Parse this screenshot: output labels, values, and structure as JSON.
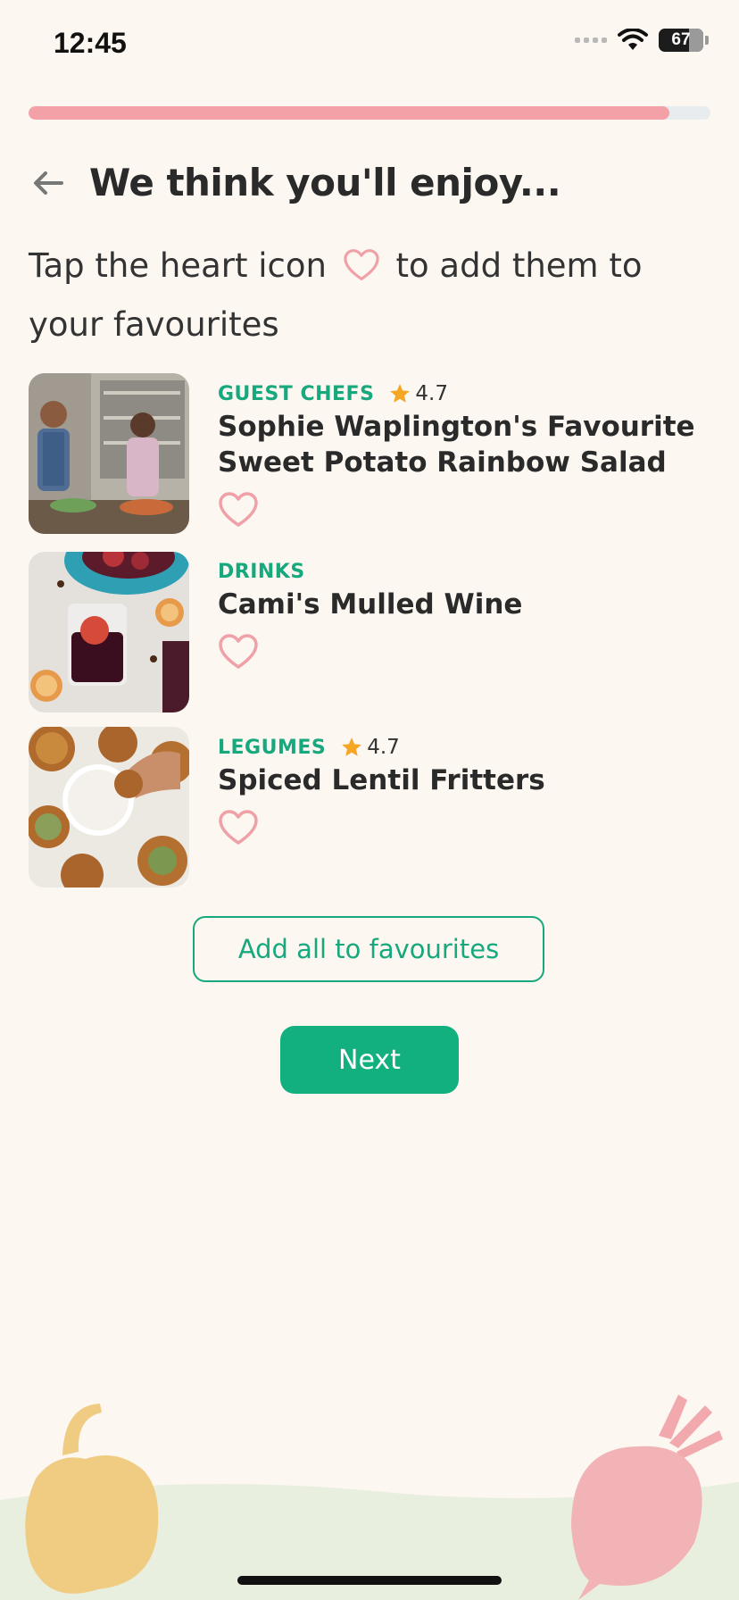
{
  "status_bar": {
    "time": "12:45",
    "battery": "67"
  },
  "progress": {
    "value": 0.94,
    "fill_color": "#f3a0a6"
  },
  "header": {
    "back_icon": "arrow-left-icon",
    "title": "We think you'll enjoy..."
  },
  "subtitle": {
    "before_icon": "Tap the heart icon",
    "icon": "heart-outline-icon",
    "after_icon": "to add them to your favourites"
  },
  "recipes": [
    {
      "category": "GUEST CHEFS",
      "rating": "4.7",
      "title": "Sophie Waplington's Favourite Sweet Potato Rainbow Salad",
      "image": "guest-chefs-photo"
    },
    {
      "category": "DRINKS",
      "rating": "",
      "title": "Cami's Mulled Wine",
      "image": "mulled-wine-photo"
    },
    {
      "category": "LEGUMES",
      "rating": "4.7",
      "title": "Spiced Lentil Fritters",
      "image": "lentil-fritters-photo"
    }
  ],
  "actions": {
    "add_all_label": "Add all to favourites",
    "next_label": "Next"
  },
  "colors": {
    "accent": "#12b07f",
    "heart": "#f0a1a7",
    "star": "#f5a623",
    "background": "#fcf7f1"
  }
}
